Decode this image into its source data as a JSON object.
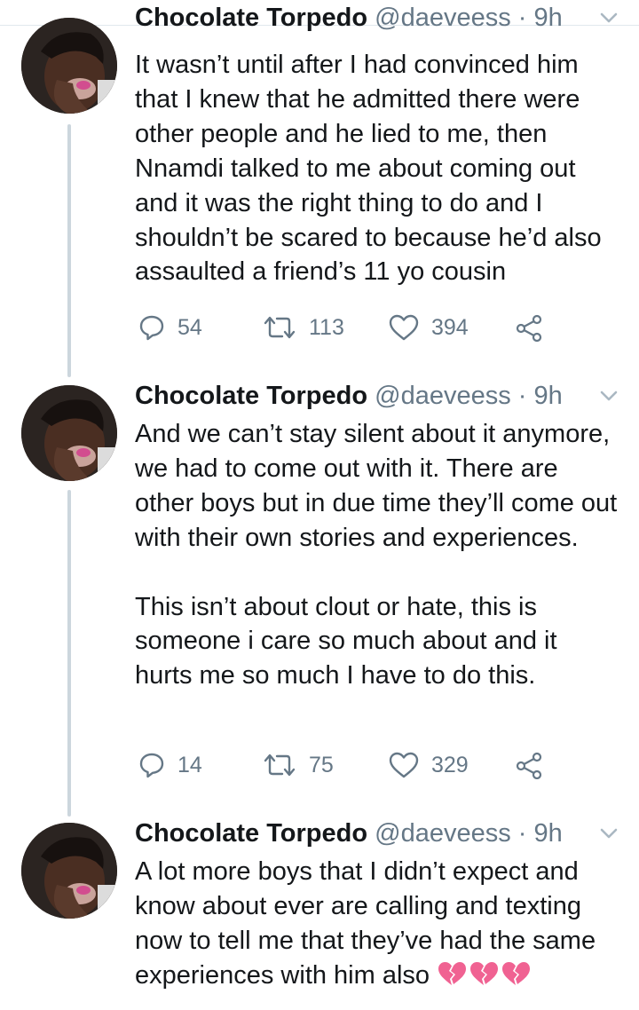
{
  "colors": {
    "text": "#14171a",
    "secondary": "#657786",
    "thread_line": "#ccd6dd",
    "broken_heart": "#f06292"
  },
  "tweets": [
    {
      "author_name": "Chocolate Torpedo",
      "handle": "@daeveess",
      "separator": "·",
      "time": "9h",
      "text": "It wasn’t until after I had convinced him that I knew that he admitted there were other people and he lied to me, then Nnamdi talked to me about coming out and it was the right thing to do and I shouldn’t be scared to because he’d also assaulted a friend’s 11 yo cousin",
      "replies": "54",
      "retweets": "113",
      "likes": "394"
    },
    {
      "author_name": "Chocolate Torpedo",
      "handle": "@daeveess",
      "separator": "·",
      "time": "9h",
      "text": "And we can’t stay silent about it anymore, we had to come out with it. There are other boys but in due time they’ll come out with their own stories and experiences.\n\nThis isn’t about clout or hate, this is someone i care so much about and it hurts me so much I have to do this.",
      "replies": "14",
      "retweets": "75",
      "likes": "329"
    },
    {
      "author_name": "Chocolate Torpedo",
      "handle": "@daeveess",
      "separator": "·",
      "time": "9h",
      "text": "A lot more boys that I didn’t expect and know about ever are calling and texting now to tell me that they’ve had the same experiences with him also",
      "emoji": "broken-heart x3"
    }
  ]
}
